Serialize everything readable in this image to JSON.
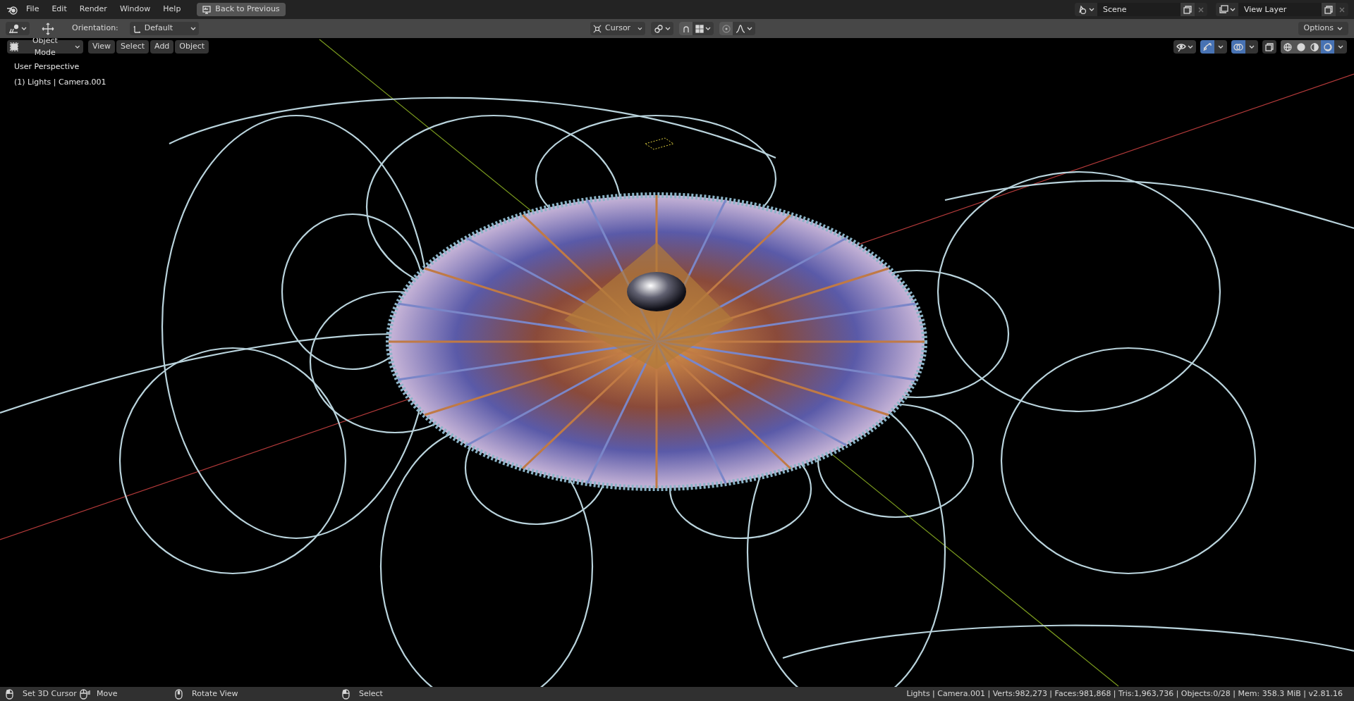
{
  "topbar": {
    "menus": [
      "File",
      "Edit",
      "Render",
      "Window",
      "Help"
    ],
    "back_button": "Back to Previous",
    "scene": {
      "value": "Scene"
    },
    "view_layer": {
      "value": "View Layer"
    }
  },
  "tool_header": {
    "orientation_label": "Orientation:",
    "orientation": "Default",
    "pivot": "Cursor",
    "snap_on": false,
    "proportional_on": false,
    "options": "Options"
  },
  "viewport_header": {
    "mode": "Object Mode",
    "menus": [
      "View",
      "Select",
      "Add",
      "Object"
    ],
    "gizmos_on": true,
    "overlays_on": true,
    "xray_on": false,
    "shading": [
      {
        "kind": "wireframe",
        "selected": false
      },
      {
        "kind": "solid",
        "selected": false
      },
      {
        "kind": "material",
        "selected": false
      },
      {
        "kind": "rendered",
        "selected": true
      }
    ]
  },
  "viewport": {
    "perspective": "User Perspective",
    "active_object": "(1) Lights | Camera.001"
  },
  "status_bar": {
    "hints": [
      {
        "kind": "left",
        "label": "Set 3D Cursor"
      },
      {
        "kind": "drag",
        "label": "Move"
      },
      {
        "kind": "middle",
        "label": "Rotate View"
      },
      {
        "kind": "left",
        "label": "Select"
      }
    ],
    "stats": "Lights | Camera.001 | Verts:982,273 | Faces:981,868 | Tris:1,963,736 | Objects:0/28 | Mem: 358.3 MiB | v2.81.16"
  }
}
